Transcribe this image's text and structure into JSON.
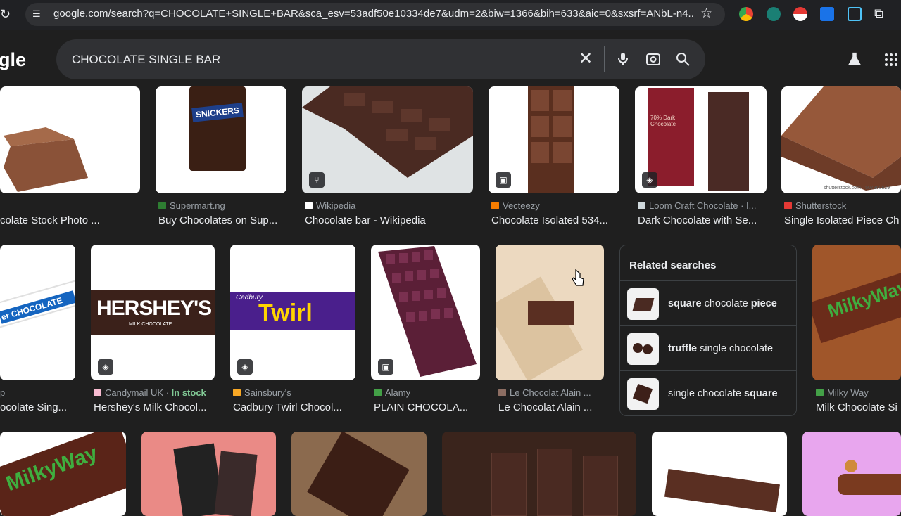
{
  "browser": {
    "url": "google.com/search?q=CHOCOLATE+SINGLE+BAR&sca_esv=53adf50e10334de7&udm=2&biw=1366&bih=633&aic=0&sxsrf=ANbL-n4..."
  },
  "header": {
    "logo": "gle",
    "query": "CHOCOLATE SINGLE BAR"
  },
  "results_row1": [
    {
      "source": "",
      "title": "colate Stock Photo ..."
    },
    {
      "source": "Supermart.ng",
      "title": "Buy Chocolates on Sup..."
    },
    {
      "source": "Wikipedia",
      "title": "Chocolate bar - Wikipedia"
    },
    {
      "source": "Vecteezy",
      "title": "Chocolate Isolated 534..."
    },
    {
      "source": "Loom Craft Chocolate · I...",
      "title": "Dark Chocolate with Se..."
    },
    {
      "source": "Shutterstock",
      "title": "Single Isolated Piece Ch"
    }
  ],
  "results_row2": [
    {
      "source": "p",
      "title": "ocolate Sing..."
    },
    {
      "source": "Candymail UK",
      "stock": "In stock",
      "title": "Hershey's Milk Chocol..."
    },
    {
      "source": "Sainsbury's",
      "title": "Cadbury Twirl Chocol..."
    },
    {
      "source": "Alamy",
      "title": "PLAIN CHOCOLA..."
    },
    {
      "source": "Le Chocolat Alain ...",
      "title": "Le Chocolat Alain ..."
    },
    {
      "source": "Milky Way",
      "title": "Milk Chocolate Si"
    }
  ],
  "related": {
    "title": "Related searches",
    "items": [
      {
        "bold1": "square",
        "plain": " chocolate ",
        "bold2": "piece"
      },
      {
        "bold1": "truffle",
        "plain": " single chocolate",
        "bold2": ""
      },
      {
        "bold1": "",
        "plain": "single chocolate ",
        "bold2": "square"
      }
    ]
  },
  "image_text": {
    "snickers": "SNICKERS",
    "hersheys": "HERSHEY'S",
    "hersheys_sub": "MILK CHOCOLATE",
    "twirl": "Twirl",
    "cadbury": "Cadbury",
    "kinder": "er CHOCOLATE",
    "milkyway": "MilkyWay",
    "shutterstock": "shutterstock.com · 507360529",
    "loom_label": "70% Dark Chocolate"
  },
  "colors": {
    "background": "#1f1f1f",
    "chocolate_dark": "#4a2a22",
    "chocolate_milk": "#8a5238",
    "in_stock": "#81c995"
  }
}
